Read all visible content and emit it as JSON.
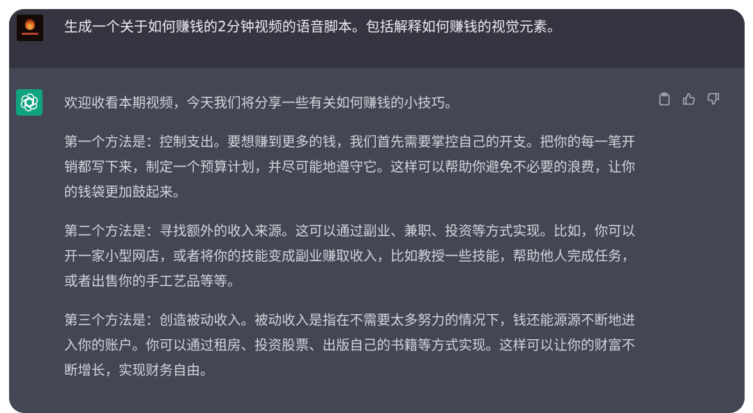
{
  "user_message": {
    "text": "生成一个关于如何赚钱的2分钟视频的语音脚本。包括解释如何赚钱的视觉元素。"
  },
  "assistant_message": {
    "paragraphs": [
      "欢迎收看本期视频，今天我们将分享一些有关如何赚钱的小技巧。",
      "第一个方法是：控制支出。要想赚到更多的钱，我们首先需要掌控自己的开支。把你的每一笔开销都写下来，制定一个预算计划，并尽可能地遵守它。这样可以帮助你避免不必要的浪费，让你的钱袋更加鼓起来。",
      "第二个方法是：寻找额外的收入来源。这可以通过副业、兼职、投资等方式实现。比如，你可以开一家小型网店，或者将你的技能变成副业赚取收入，比如教授一些技能，帮助他人完成任务，或者出售你的手工艺品等等。",
      "第三个方法是：创造被动收入。被动收入是指在不需要太多努力的情况下，钱还能源源不断地进入你的账户。你可以通过租房、投资股票、出版自己的书籍等方式实现。这样可以让你的财富不断增长，实现财务自由。"
    ]
  },
  "icons": {
    "copy": "clipboard-icon",
    "like": "thumbs-up-icon",
    "dislike": "thumbs-down-icon",
    "assistant_avatar": "openai-logo-icon"
  },
  "colors": {
    "user_bg": "#343541",
    "assistant_bg": "#444654",
    "assistant_avatar": "#10a37f",
    "text": "#d1d5db"
  }
}
